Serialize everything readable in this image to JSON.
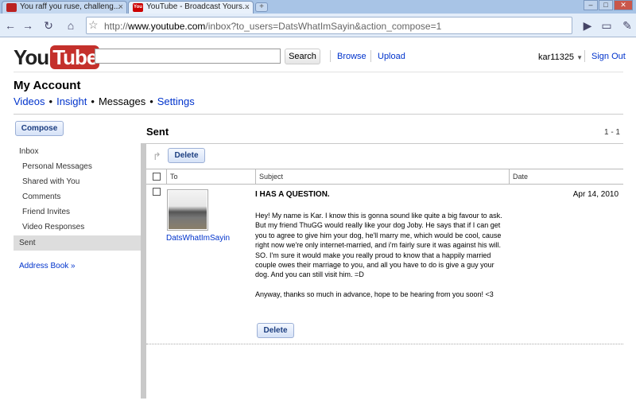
{
  "browser": {
    "tabs": [
      {
        "title": "You raff you ruse, challeng...",
        "active": false
      },
      {
        "title": "YouTube - Broadcast Yours...",
        "active": true
      }
    ],
    "url_prefix": "http://",
    "url_host": "www.youtube.com",
    "url_path": "/inbox?to_users=DatsWhatImSayin&action_compose=1"
  },
  "header": {
    "logo_you": "You",
    "logo_tube": "Tube",
    "search_button": "Search",
    "browse": "Browse",
    "upload": "Upload",
    "username": "kar11325",
    "sign_out": "Sign Out"
  },
  "account": {
    "title": "My Account",
    "nav": [
      {
        "label": "Videos"
      },
      {
        "label": "Insight"
      },
      {
        "label": "Messages"
      },
      {
        "label": "Settings"
      }
    ]
  },
  "sidebar": {
    "compose": "Compose",
    "items": [
      {
        "label": "Inbox"
      },
      {
        "label": "Personal Messages"
      },
      {
        "label": "Shared with You"
      },
      {
        "label": "Comments"
      },
      {
        "label": "Friend Invites"
      },
      {
        "label": "Video Responses"
      },
      {
        "label": "Sent"
      }
    ],
    "address_book": "Address Book »"
  },
  "main": {
    "title": "Sent",
    "pager": "1 - 1",
    "delete": "Delete",
    "columns": {
      "to": "To",
      "subject": "Subject",
      "date": "Date"
    },
    "message": {
      "sender": "DatsWhatImSayin",
      "subject": "I HAS A QUESTION.",
      "date": "Apr 14, 2010",
      "paragraph1": "Hey! My name is Kar. I know this is gonna sound like quite a big favour to ask. But my friend ThuGG would really like your dog Joby. He says that if I can get you to agree to give him your dog, he'll marry me, which would be cool, cause right now we're only internet-married, and i'm fairly sure it was against his will. SO. I'm sure it would make you really proud to know that a happily married couple owes their marriage to you, and all you have to do is give a guy your dog. And you can still visit him. =D",
      "paragraph2": "Anyway, thanks so much in advance, hope to be hearing from you soon! <3",
      "delete": "Delete"
    }
  }
}
